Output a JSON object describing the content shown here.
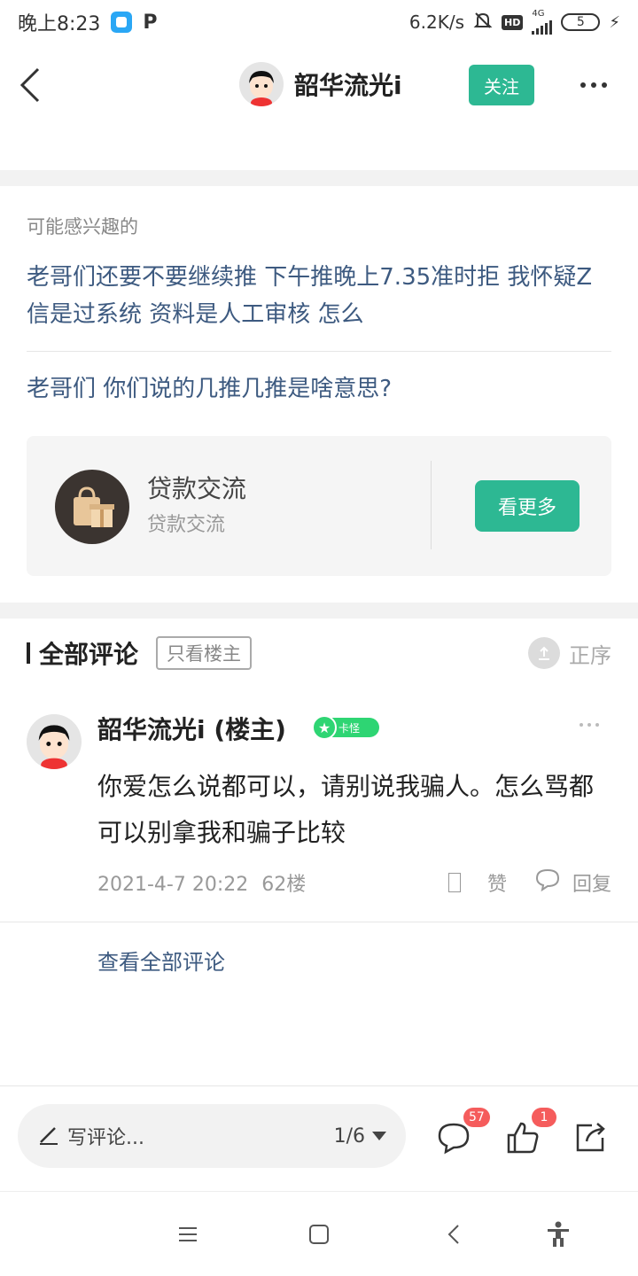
{
  "status_bar": {
    "time": "晚上8:23",
    "network_speed": "6.2K/s",
    "network_type": "4G",
    "hd_label": "HD",
    "battery": "5",
    "icons": [
      "blue-app-icon",
      "p-app-icon",
      "mute-bell-icon",
      "signal-icon",
      "battery-icon",
      "charging-icon"
    ]
  },
  "header": {
    "username": "韶华流光i",
    "follow_label": "关注"
  },
  "interest": {
    "label": "可能感兴趣的",
    "links": [
      "老哥们还要不要继续推 下午推晚上7.35准时拒 我怀疑Z信是过系统 资料是人工审核 怎么",
      "老哥们 你们说的几推几推是啥意思?"
    ]
  },
  "forum_card": {
    "title": "贷款交流",
    "subtitle": "贷款交流",
    "button_label": "看更多"
  },
  "comments": {
    "title": "全部评论",
    "only_op_label": "只看楼主",
    "sort_label": "正序",
    "items": [
      {
        "author": "韶华流光i (楼主)",
        "level": "卡怪",
        "text": "你爱怎么说都可以，请别说我骗人。怎么骂都可以别拿我和骗子比较",
        "time": "2021-4-7 20:22",
        "floor": "62楼",
        "like_label": "赞",
        "reply_label": "回复"
      }
    ],
    "view_all_label": "查看全部评论"
  },
  "bottom_bar": {
    "write_label": "写评论...",
    "page": "1/6",
    "comment_count": "57",
    "like_count": "1"
  },
  "colors": {
    "accent": "#2db893",
    "link": "#3d5a80",
    "badge": "#f55c5c"
  }
}
